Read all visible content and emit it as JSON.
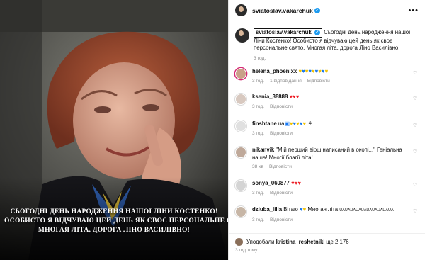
{
  "post": {
    "author": "sviatoslav.vakarchuk",
    "image_caption_lines": [
      "СЬОГОДНІ ДЕНЬ НАРОДЖЕННЯ НАШОЇ ЛІНИ КОСТЕНКО!",
      "ОСОБИСТО Я ВІДЧУВАЮ ЦЕЙ ДЕНЬ ЯК СВОЄ ПЕРСОНАЛЬНЕ СВЯТО.",
      "МНОГАЯ ЛІТА, ДОРОГА ЛІНО ВАСИЛІВНО!"
    ],
    "caption_text": "Сьогодні день народження нашої Ліни Костенко! Особисто я відчуваю цей день як своє персональне свято. Многая літа, дорога Ліно Василівно!",
    "caption_time": "3 год."
  },
  "comments": [
    {
      "user": "helena_phoenixx",
      "text": "💛💙💛💙💛💙💛💙💛",
      "time": "3 год.",
      "likes": "",
      "replies": "1 відповідання",
      "reply": "Відповісти"
    },
    {
      "user": "ksenia_38888",
      "text": "❤️❤️❤️",
      "time": "3 год.",
      "likes": "",
      "replies": "",
      "reply": "Відповісти"
    },
    {
      "user": "finshtane",
      "text": "ua🇺🇦💛💙💛💙💛🙏",
      "time": "3 год.",
      "likes": "",
      "replies": "",
      "reply": "Відповісти"
    },
    {
      "user": "nikanvik",
      "text": "\"Мій перший вірш,написаний в окопі...\" Геніальна наша! Многії благії літа!",
      "time": "38 хв",
      "likes": "",
      "replies": "",
      "reply": "Відповісти"
    },
    {
      "user": "sonya_060877",
      "text": "❤️❤️❤️",
      "time": "3 год.",
      "likes": "",
      "replies": "",
      "reply": "Відповісти"
    },
    {
      "user": "dziuba_lilia",
      "text": "Вітаю 💙💛 Многая літа 🇺🇦UAUAUAUAUAUAUAUAUAUA",
      "time": "3 год.",
      "likes": "",
      "replies": "",
      "reply": "Відповісти"
    }
  ],
  "footer": {
    "liked_by_prefix": "Уподобали ",
    "liked_by_user": "kristina_reshetnik",
    "liked_by_suffix": " і ще 2 176",
    "time": "3 год тому"
  },
  "colors": {
    "verified": "#1d9bf0",
    "muted": "#8e8e8e"
  }
}
